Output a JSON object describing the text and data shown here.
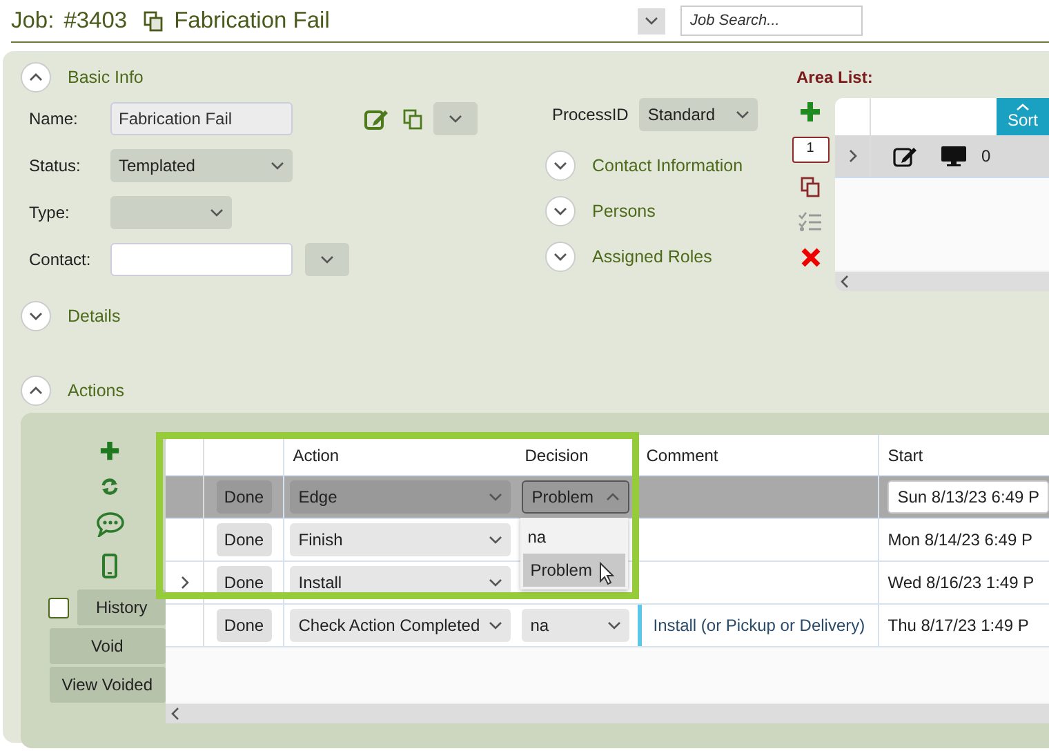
{
  "header": {
    "job_label": "Job:",
    "job_number": "#3403",
    "job_name": "Fabrication Fail",
    "search": {
      "placeholder": "Job Search..."
    }
  },
  "basic_info": {
    "title": "Basic Info",
    "expanded": true,
    "fields": [
      {
        "kind": "text",
        "label": "Name:",
        "value": "Fabrication Fail",
        "readonly": true
      },
      {
        "kind": "select",
        "label": "Status:",
        "value": "Templated"
      },
      {
        "kind": "select",
        "label": "Type:"
      },
      {
        "kind": "lookup",
        "label": "Contact:"
      }
    ]
  },
  "process": {
    "label": "ProcessID",
    "value": "Standard"
  },
  "side_sections": [
    {
      "title": "Contact Information",
      "expanded": false
    },
    {
      "title": "Persons",
      "expanded": false
    },
    {
      "title": "Assigned Roles",
      "expanded": false
    }
  ],
  "details": {
    "title": "Details",
    "expanded": false
  },
  "area_list": {
    "title": "Area List:",
    "count": "1",
    "sort_label": "Sort",
    "rows": [
      {
        "value": "0"
      }
    ]
  },
  "actions": {
    "title": "Actions",
    "expanded": true,
    "history_checked": false,
    "buttons": [
      "History",
      "Void",
      "View Voided"
    ],
    "columns": [
      "Action",
      "Decision",
      "Comment",
      "Start"
    ],
    "rows": [
      {
        "selected": true,
        "expander": false,
        "done": "Done",
        "action": "Edge",
        "decision": "Problem",
        "menu_open": true,
        "comment": "",
        "start": "Sun 8/13/23 6:49 P"
      },
      {
        "selected": false,
        "expander": false,
        "done": "Done",
        "action": "Finish",
        "comment": "",
        "start": "Mon 8/14/23 6:49 P"
      },
      {
        "selected": false,
        "expander": true,
        "done": "Done",
        "action": "Install",
        "comment": "",
        "start": "Wed 8/16/23 1:49 P"
      },
      {
        "selected": false,
        "expander": false,
        "done": "Done",
        "action": "Check Action Completed",
        "decision": "na",
        "menu_open": false,
        "comment": "Install (or Pickup or Delivery)",
        "start": "Thu 8/17/23 1:49 P"
      }
    ],
    "decision_options": [
      {
        "label": "na",
        "hovered": false
      },
      {
        "label": "Problem",
        "hovered": true
      }
    ]
  }
}
